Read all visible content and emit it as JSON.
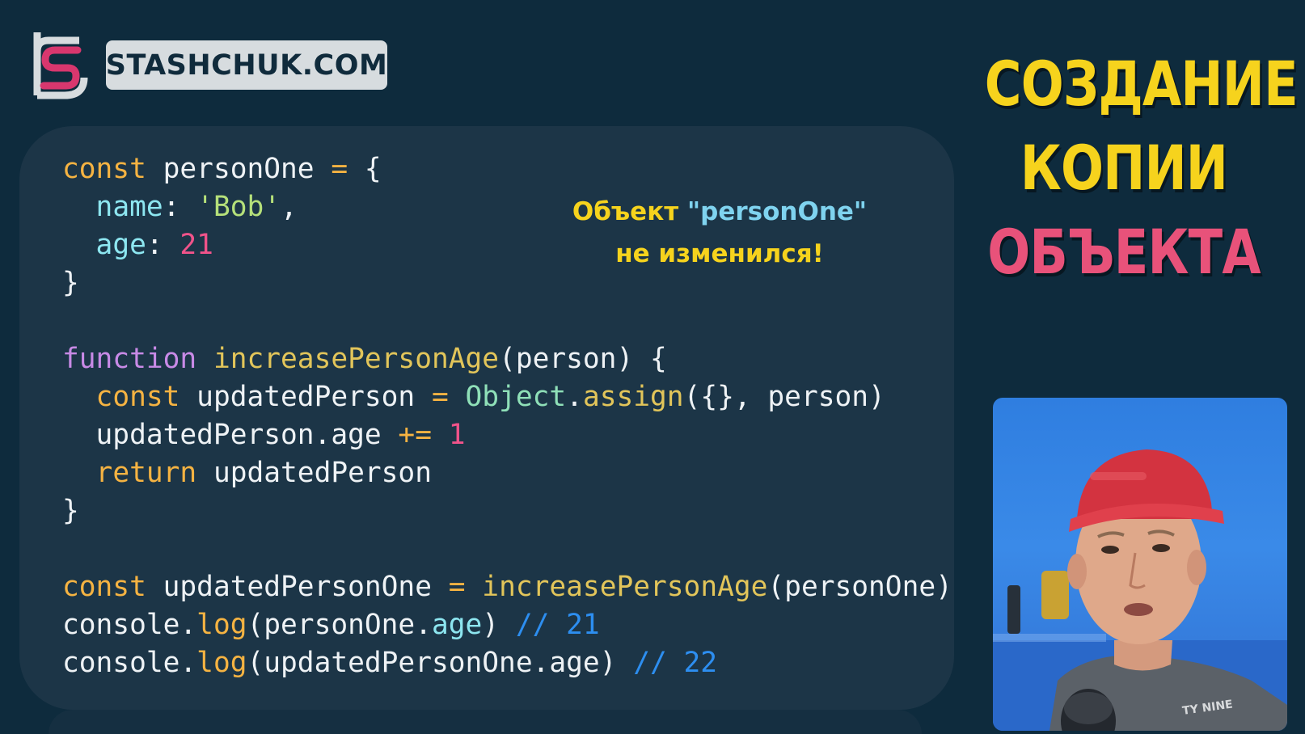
{
  "logo": {
    "brand_text": "STASHCHUK.COM"
  },
  "code": {
    "lines": [
      [
        {
          "t": "const",
          "c": "kw"
        },
        {
          "t": " personOne ",
          "c": ""
        },
        {
          "t": "=",
          "c": "op"
        },
        {
          "t": " {",
          "c": ""
        }
      ],
      [
        {
          "t": "  ",
          "c": ""
        },
        {
          "t": "name",
          "c": "pp"
        },
        {
          "t": ": ",
          "c": ""
        },
        {
          "t": "'Bob'",
          "c": "st"
        },
        {
          "t": ",",
          "c": ""
        }
      ],
      [
        {
          "t": "  ",
          "c": ""
        },
        {
          "t": "age",
          "c": "pp"
        },
        {
          "t": ": ",
          "c": ""
        },
        {
          "t": "21",
          "c": "nm"
        }
      ],
      [
        {
          "t": "}",
          "c": ""
        }
      ],
      [],
      [
        {
          "t": "function",
          "c": "pr"
        },
        {
          "t": " ",
          "c": ""
        },
        {
          "t": "increasePersonAge",
          "c": "fn"
        },
        {
          "t": "(person) {",
          "c": ""
        }
      ],
      [
        {
          "t": "  ",
          "c": ""
        },
        {
          "t": "const",
          "c": "kw"
        },
        {
          "t": " updatedPerson ",
          "c": ""
        },
        {
          "t": "=",
          "c": "op"
        },
        {
          "t": " ",
          "c": ""
        },
        {
          "t": "Object",
          "c": "ob"
        },
        {
          "t": ".",
          "c": ""
        },
        {
          "t": "assign",
          "c": "fn"
        },
        {
          "t": "({}, person)",
          "c": ""
        }
      ],
      [
        {
          "t": "  updatedPerson.age ",
          "c": ""
        },
        {
          "t": "+=",
          "c": "op"
        },
        {
          "t": " ",
          "c": ""
        },
        {
          "t": "1",
          "c": "nm"
        }
      ],
      [
        {
          "t": "  ",
          "c": ""
        },
        {
          "t": "return",
          "c": "kw"
        },
        {
          "t": " updatedPerson",
          "c": ""
        }
      ],
      [
        {
          "t": "}",
          "c": ""
        }
      ],
      [],
      [
        {
          "t": "const",
          "c": "kw"
        },
        {
          "t": " updatedPersonOne ",
          "c": ""
        },
        {
          "t": "=",
          "c": "op"
        },
        {
          "t": " ",
          "c": ""
        },
        {
          "t": "increasePersonAge",
          "c": "fn"
        },
        {
          "t": "(personOne)",
          "c": ""
        }
      ],
      [
        {
          "t": "console.",
          "c": ""
        },
        {
          "t": "log",
          "c": "kw"
        },
        {
          "t": "(personOne.",
          "c": ""
        },
        {
          "t": "age",
          "c": "pp"
        },
        {
          "t": ") ",
          "c": ""
        },
        {
          "t": "// 21",
          "c": "cm"
        }
      ],
      [
        {
          "t": "console.",
          "c": ""
        },
        {
          "t": "log",
          "c": "kw"
        },
        {
          "t": "(updatedPersonOne.age) ",
          "c": ""
        },
        {
          "t": "// 22",
          "c": "cm"
        }
      ]
    ]
  },
  "note": {
    "line1_prefix": "Объект ",
    "line1_quoted": "\"personOne\"",
    "line2": "не изменился!"
  },
  "title": {
    "line1": "СОЗДАНИЕ",
    "line2": "КОПИИ",
    "line3": "ОБЪЕКТА"
  },
  "colors": {
    "background": "#0e2b3d",
    "code_panel": "#1c3547",
    "title_yellow": "#f6d31d",
    "title_pink": "#e8527a",
    "logo_pink": "#d8376e",
    "keyword": "#f5b342",
    "comment": "#2d8ef0"
  },
  "webcam": {
    "icon": "presenter-video"
  }
}
